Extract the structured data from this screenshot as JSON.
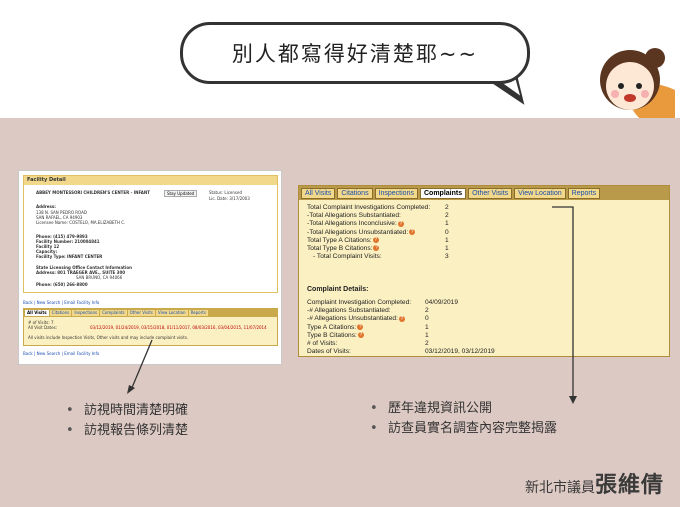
{
  "speech_bubble": {
    "text": "別人都寫得好清楚耶~~"
  },
  "left_screenshot": {
    "panel_title": "Facility Detail",
    "facility_name": "ABBEY MONTESSORI CHILDREN'S CENTER - INFANT",
    "stay_updated_label": "Stay Updated",
    "status_line": "Status: Licensed",
    "lic_date_line": "Lic. Date: 3/17/2003",
    "address_label": "Address:",
    "address_lines": [
      "138 N. SAN PEDRO ROAD",
      "SAN RAFAEL, CA 94903",
      "Licensee Name: COSTELO, MA.ELIZABETH C."
    ],
    "phone_line": "Phone:          (415) 479-9893",
    "facility_number_line": "Facility Number: 210004841",
    "facility_line": "Facility          12",
    "capacity_line": "Capacity:",
    "facility_type_line": "Facility Type:    INFANT CENTER",
    "state_office_label": "State Licensing Office Contact Information",
    "office_address_lines": [
      "Address:        801 TRAEGER AVE., SUITE 300",
      "SAN BRUNO, CA 94066"
    ],
    "office_phone_line": "Phone:          (650) 266-8800",
    "links": "Back | New Search | Email Facility Info",
    "tabs": [
      "All Visits",
      "Citations",
      "Inspections",
      "Complaints",
      "Other Visits",
      "View Location",
      "Reports"
    ],
    "visits_count_line": "# of Visits:                    7",
    "all_visit_dates_label": "All Visit Dates:",
    "all_visit_dates_value": "03/12/2019, 01/24/2019, 03/15/2018, 01/11/2017, 08/03/2016, 03/04/2015, 11/07/2014",
    "note": "All visits include Inspection Visits, Other visits and may include complaint visits.",
    "links_bottom": "Back | New Search | Email Facility Info"
  },
  "right_screenshot": {
    "tabs": [
      "All Visits",
      "Citations",
      "Inspections",
      "Complaints",
      "Other Visits",
      "View Location",
      "Reports"
    ],
    "active_tab": "Complaints",
    "summary": [
      {
        "label": "Total Complaint Investigations Completed:",
        "value": "2",
        "icon": false
      },
      {
        "label": "-Total Allegations Substantiated:",
        "value": "2",
        "icon": false
      },
      {
        "label": "-Total Allegations Inconclusive:",
        "value": "1",
        "icon": true
      },
      {
        "label": "-Total Allegations Unsubstantiated:",
        "value": "0",
        "icon": true
      },
      {
        "label": "Total Type A Citations:",
        "value": "1",
        "icon": true
      },
      {
        "label": "Total Type B Citations:",
        "value": "1",
        "icon": true
      },
      {
        "label": "- Total Complaint Visits:",
        "value": "3",
        "icon": false
      }
    ],
    "details_title": "Complaint Details:",
    "details": [
      {
        "label": "Complaint Investigation Completed:",
        "value": "04/09/2019",
        "icon": false
      },
      {
        "label": "-# Allegations Substantiated:",
        "value": "2",
        "icon": false
      },
      {
        "label": "-# Allegations Unsubstantiated:",
        "value": "0",
        "icon": true
      },
      {
        "label": "Type A Citations:",
        "value": "1",
        "icon": true
      },
      {
        "label": "Type B Citations:",
        "value": "1",
        "icon": true
      },
      {
        "label": "# of Visits:",
        "value": "2",
        "icon": false
      },
      {
        "label": "Dates of Visits:",
        "value": "03/12/2019, 03/12/2019",
        "icon": false
      }
    ]
  },
  "bullets_left": [
    "訪視時間清楚明確",
    "訪視報告條列清楚"
  ],
  "bullets_right": [
    "歷年違規資訊公開",
    "訪查員實名調查內容完整揭露"
  ],
  "signature": {
    "prefix": "新北市議員",
    "name": "張維倩"
  },
  "colors": {
    "pink_bg": "#dcc9c3",
    "panel_bg": "#fbf0c2",
    "tab_bg": "#f2d88a",
    "link": "#1a4fb0",
    "info_icon": "#e0742a"
  },
  "icons": {
    "info": "info-icon",
    "character": "girl-character-illustration"
  }
}
